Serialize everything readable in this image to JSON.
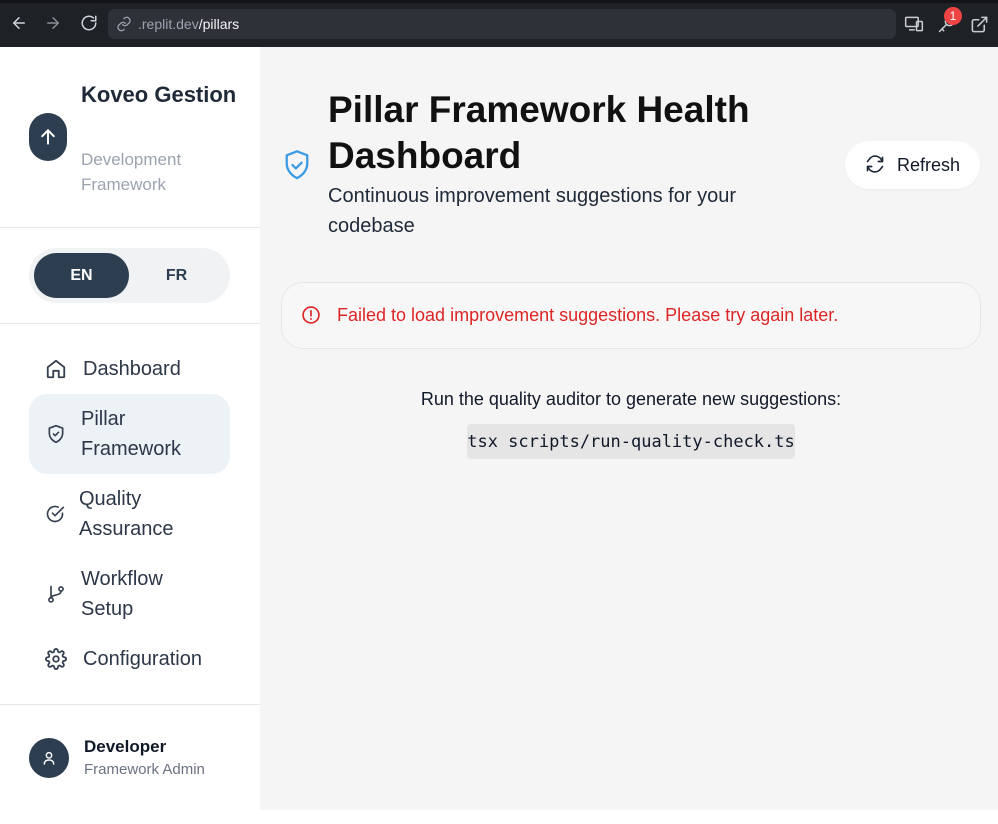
{
  "browser": {
    "url_host": ".replit.dev",
    "url_path": "/pillars",
    "notification_count": "1"
  },
  "sidebar": {
    "brand_title": "Koveo Gestion",
    "brand_subtitle": "Development Framework",
    "languages": {
      "en": "EN",
      "fr": "FR",
      "selected": "EN"
    },
    "items": [
      {
        "label": "Dashboard",
        "icon": "home-icon",
        "active": false
      },
      {
        "label": "Pillar Framework",
        "icon": "shield-check-icon",
        "active": true
      },
      {
        "label": "Quality Assurance",
        "icon": "circle-check-icon",
        "active": false
      },
      {
        "label": "Workflow Setup",
        "icon": "git-branch-icon",
        "active": false
      },
      {
        "label": "Configuration",
        "icon": "gear-icon",
        "active": false
      }
    ],
    "user": {
      "name": "Developer",
      "role": "Framework Admin"
    }
  },
  "main": {
    "title": "Pillar Framework Health Dashboard",
    "subtitle": "Continuous improvement suggestions for your codebase",
    "refresh_label": "Refresh",
    "error_message": "Failed to load improvement suggestions. Please try again later.",
    "hint": "Run the quality auditor to generate new suggestions:",
    "command": "tsx scripts/run-quality-check.ts"
  },
  "colors": {
    "accent": "#2c3e50",
    "error": "#dc2626",
    "title_icon": "#3b9ae1"
  }
}
